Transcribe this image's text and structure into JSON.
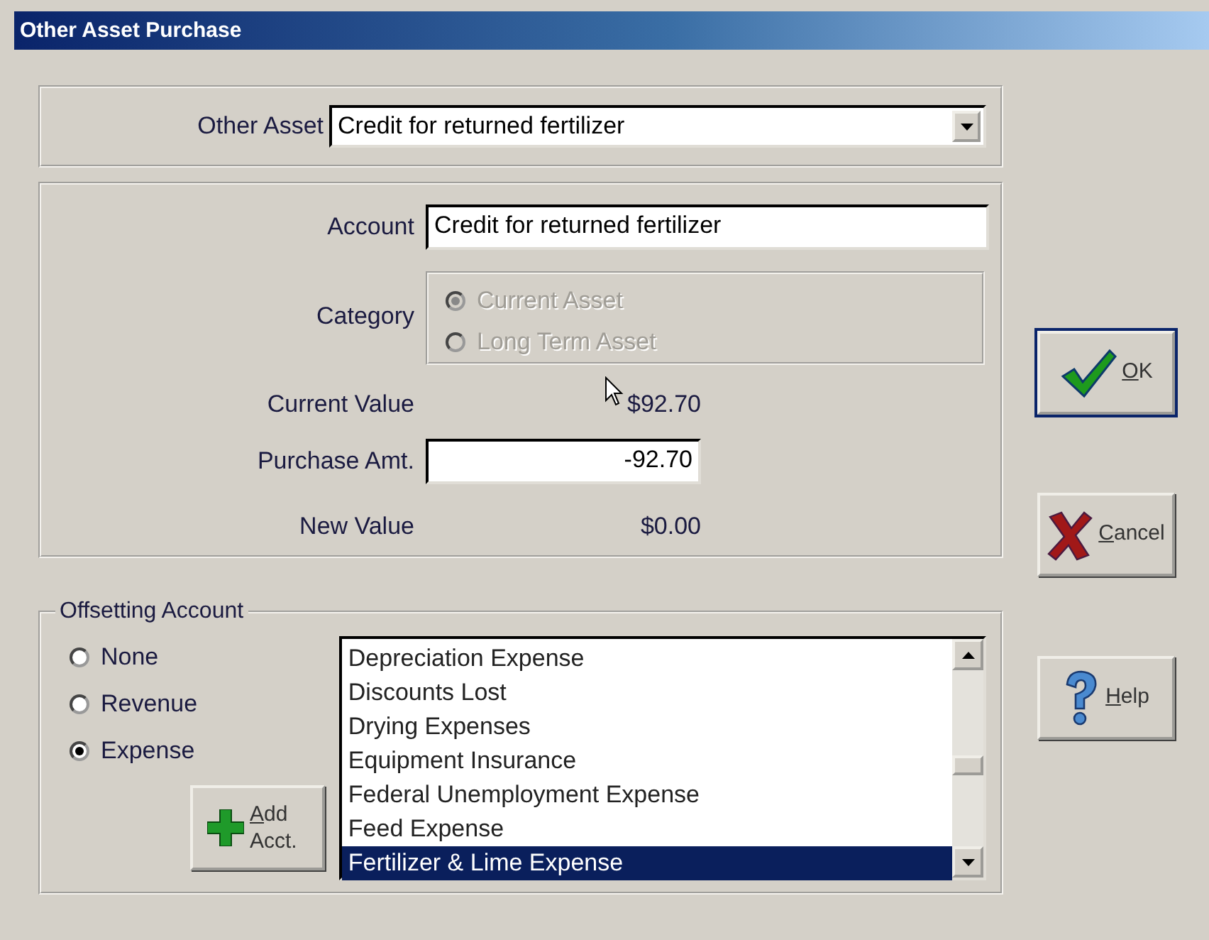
{
  "window": {
    "title": "Other Asset Purchase"
  },
  "other_asset": {
    "label": "Other Asset",
    "value": "Credit for returned fertilizer"
  },
  "account": {
    "label": "Account",
    "value": "Credit for returned fertilizer"
  },
  "category": {
    "label": "Category",
    "disabled": true,
    "options": [
      {
        "label": "Current Asset",
        "selected": true
      },
      {
        "label": "Long Term Asset",
        "selected": false
      }
    ]
  },
  "values": [
    {
      "kind": "text",
      "label": "Current Value",
      "value": "$92.70"
    },
    {
      "kind": "input",
      "label": "Purchase Amt.",
      "value": "-92.70"
    },
    {
      "kind": "text",
      "label": "New Value",
      "value": "$0.00"
    }
  ],
  "offsetting": {
    "title": "Offsetting Account",
    "options": [
      {
        "label": "None",
        "selected": false
      },
      {
        "label": "Revenue",
        "selected": false
      },
      {
        "label": "Expense",
        "selected": true
      }
    ],
    "add_button": {
      "label": "Add Acct."
    },
    "accounts": [
      {
        "label": "Depreciation Expense",
        "selected": false
      },
      {
        "label": "Discounts Lost",
        "selected": false
      },
      {
        "label": "Drying Expenses",
        "selected": false
      },
      {
        "label": "Equipment Insurance",
        "selected": false
      },
      {
        "label": "Federal Unemployment Expense",
        "selected": false
      },
      {
        "label": "Feed Expense",
        "selected": false
      },
      {
        "label": "Fertilizer & Lime Expense",
        "selected": true
      }
    ]
  },
  "buttons": [
    {
      "kind": "ok",
      "label": "OK"
    },
    {
      "kind": "cancel",
      "label": "Cancel"
    },
    {
      "kind": "help",
      "label": "Help"
    }
  ]
}
